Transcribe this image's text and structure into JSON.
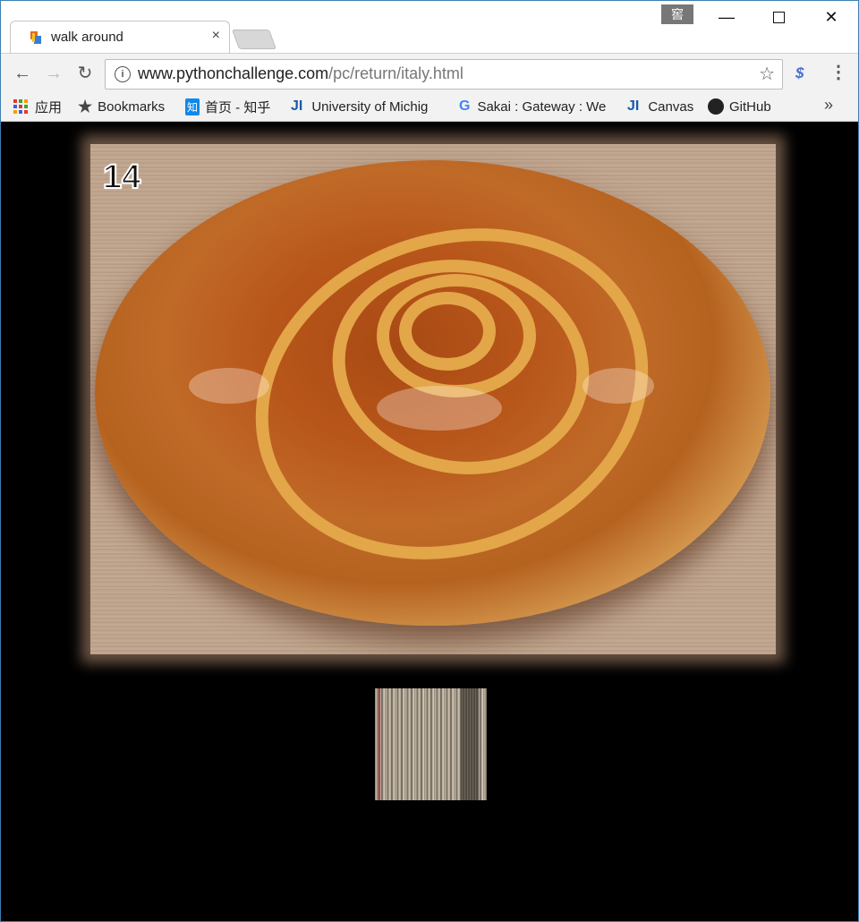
{
  "tab": {
    "title": "walk around"
  },
  "profile": {
    "label": "窖"
  },
  "window_controls": {
    "minimize": "—",
    "close": "✕"
  },
  "toolbar": {
    "url_host": "www.pythonchallenge.com",
    "url_path": "/pc/return/italy.html"
  },
  "bookmarks": {
    "apps": "应用",
    "bookmarks": "Bookmarks",
    "zhihu": "首页 - 知乎",
    "umich": "University of Michig",
    "sakai": "Sakai : Gateway : We",
    "canvas": "Canvas",
    "github": "GitHub",
    "more": "»"
  },
  "page": {
    "level_number": "14"
  },
  "colors": {
    "accent": "#1a73e8",
    "zhihu": "#0f88eb",
    "background": "#000000"
  }
}
